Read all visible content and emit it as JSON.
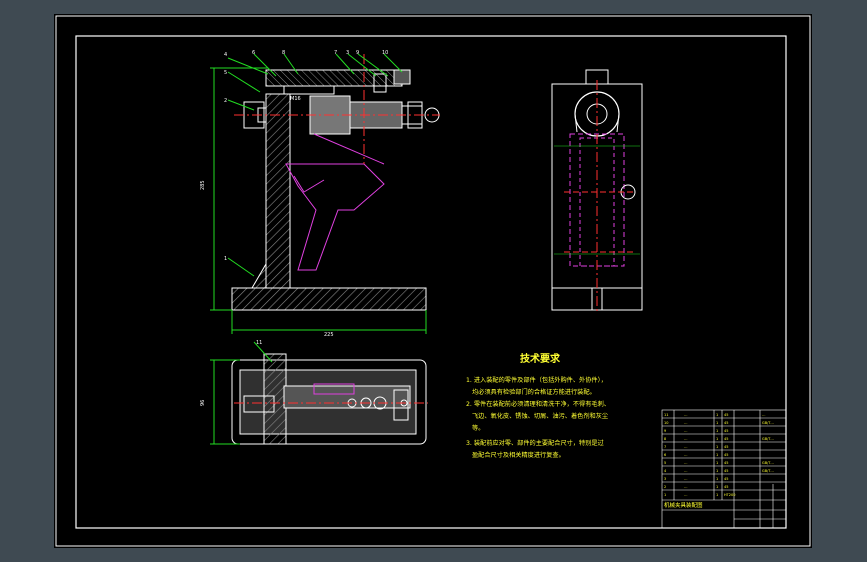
{
  "tech_requirements": {
    "title": "技术要求",
    "lines": [
      "1. 进入装配的零件及部件（包括外购件、外协件），",
      "均必须具有检验部门的合格证方能进行装配。",
      "2. 零件在装配前必须清理和清洗干净，不得有毛刺、",
      "飞边、氧化皮、锈蚀、切屑、油污、着色剂和灰尘",
      "等。",
      "3. 装配前应对零、部件的主要配合尺寸，特别是过",
      "盈配合尺寸及相关精度进行复查。"
    ]
  },
  "title_block": {
    "drawing_name": "机械夹具装配图",
    "rows": [
      [
        "11",
        "…",
        "1",
        "45",
        "…"
      ],
      [
        "10",
        "…",
        "1",
        "45",
        "GB/T…"
      ],
      [
        "9",
        "…",
        "1",
        "45",
        ""
      ],
      [
        "8",
        "…",
        "1",
        "45",
        "GB/T…"
      ],
      [
        "7",
        "…",
        "1",
        "45",
        ""
      ],
      [
        "6",
        "…",
        "1",
        "45",
        ""
      ],
      [
        "5",
        "…",
        "1",
        "45",
        "GB/T…"
      ],
      [
        "4",
        "…",
        "1",
        "45",
        "GB/T…"
      ],
      [
        "3",
        "…",
        "1",
        "45",
        ""
      ],
      [
        "2",
        "…",
        "1",
        "45",
        ""
      ],
      [
        "1",
        "…",
        "1",
        "HT200",
        ""
      ]
    ]
  },
  "dimensions": {
    "height": "285",
    "width": "225",
    "plan_depth": "96",
    "bolt_label": "M16"
  },
  "part_numbers": [
    "1",
    "2",
    "3",
    "4",
    "5",
    "6",
    "7",
    "8",
    "9",
    "10",
    "11"
  ],
  "colors": {
    "sheet": "#000000",
    "frame": "#ffffff",
    "dim_green": "#22dd22",
    "center_red": "#ff3030",
    "hidden_magenta": "#e040e0",
    "hatch_gray": "#9a9a9a",
    "text_yellow": "#ffff33"
  }
}
